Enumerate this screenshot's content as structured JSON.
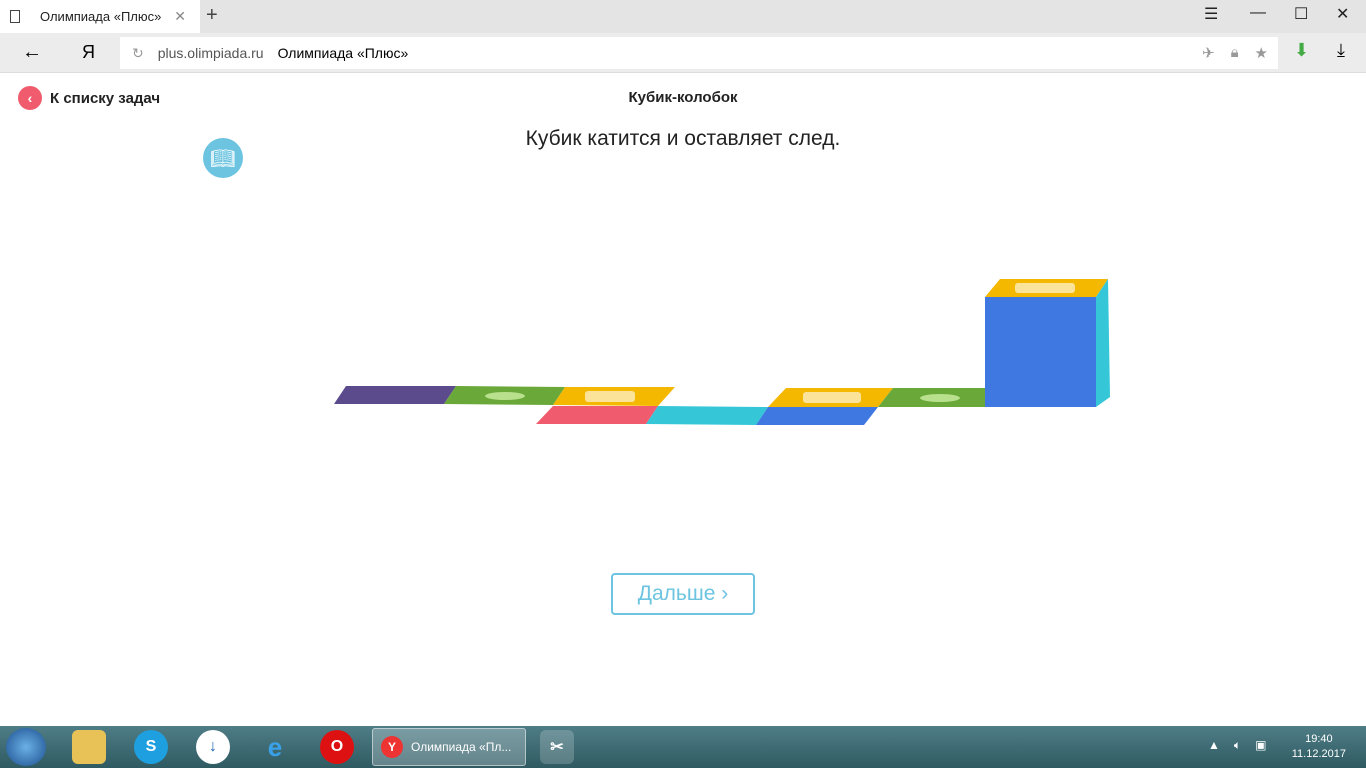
{
  "browser": {
    "tab_title": "Олимпиада «Плюс»",
    "url_host": "plus.olimpiada.ru",
    "url_title": "Олимпиада «Плюс»",
    "yandex_logo": "Я"
  },
  "page": {
    "back_link": "К списку задач",
    "title": "Кубик-колобок",
    "task_text": "Кубик катится и оставляет след.",
    "next_button": "Дальше ›"
  },
  "taskbar": {
    "active_window": "Олимпиада «Пл...",
    "time": "19:40",
    "date": "11.12.2017"
  },
  "colors": {
    "accent": "#6cc4e0",
    "back": "#f05b6d",
    "purple": "#5c4b8c",
    "green": "#6aa83a",
    "yellow": "#f5b800",
    "red": "#f05b6d",
    "blue": "#3f78e0",
    "cyan": "#35c6d8"
  }
}
